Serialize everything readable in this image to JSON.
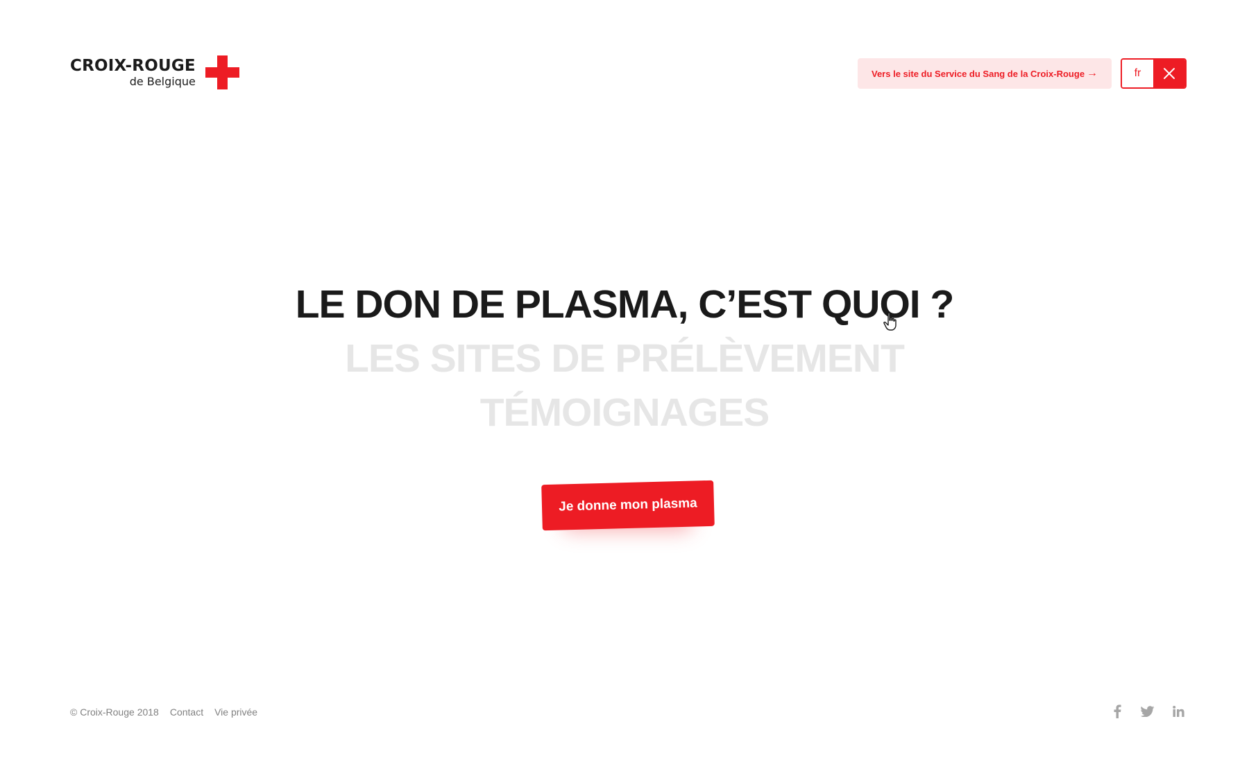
{
  "brand": {
    "name": "CROIX-ROUGE",
    "subtitle": "de Belgique",
    "accent_color": "#ed1c24"
  },
  "header": {
    "blood_service_link": "Vers le site du Service du Sang de la Croix-Rouge",
    "blood_service_arrow": "→",
    "language": "fr",
    "close_icon": "close-icon"
  },
  "hero": {
    "title": "LE DON DE PLASMA, C’EST QUOI ?",
    "items": [
      "LES SITES DE PRÉLÈVEMENT",
      "TÉMOIGNAGES"
    ],
    "cta_label": "Je donne mon plasma"
  },
  "footer": {
    "copyright": "© Croix-Rouge",
    "year": "2018",
    "links": [
      "Contact",
      "Vie privée"
    ],
    "social_icons": [
      "facebook-icon",
      "twitter-icon",
      "linkedin-icon"
    ]
  }
}
